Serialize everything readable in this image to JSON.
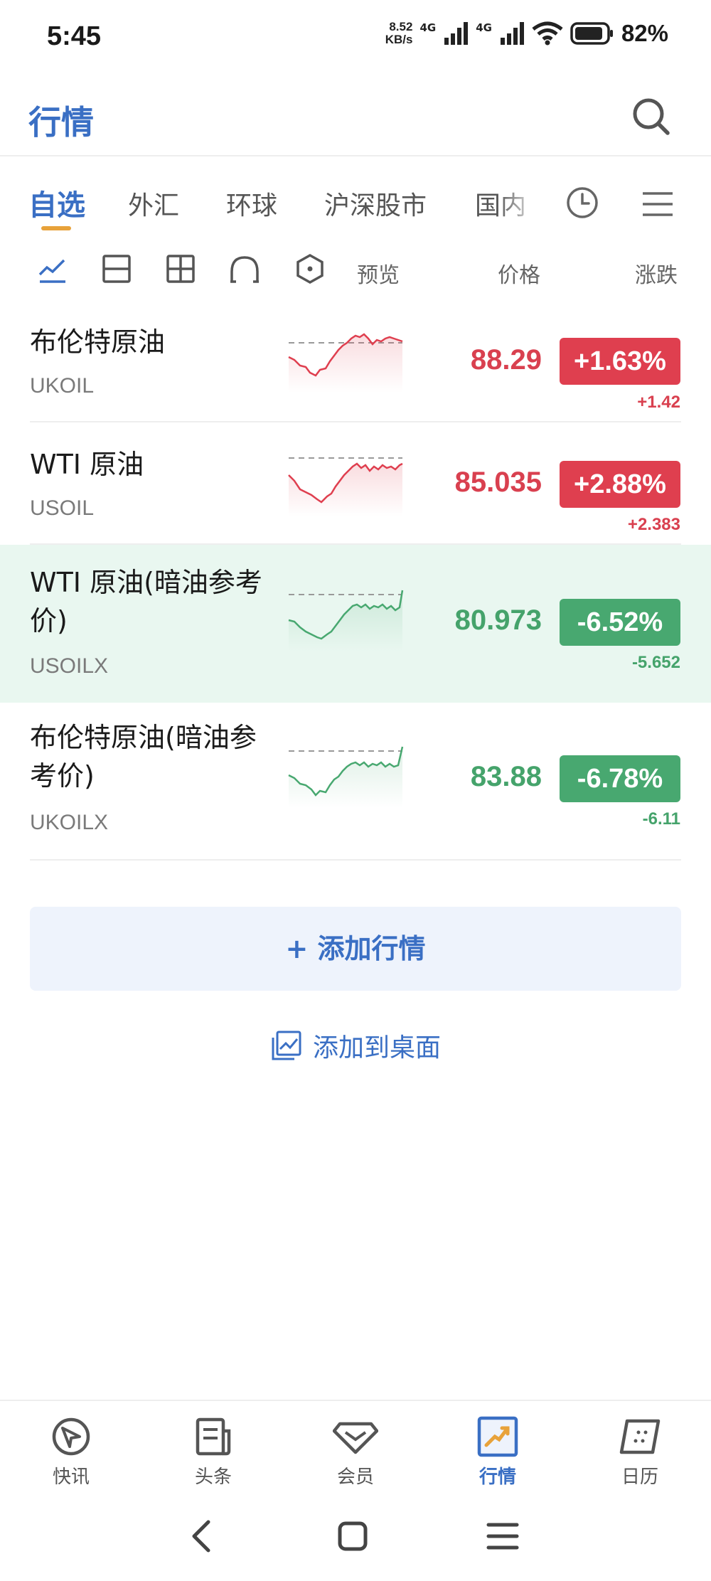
{
  "status_bar": {
    "time": "5:45",
    "speed_value": "8.52",
    "speed_unit": "KB/s",
    "network_1": "4G",
    "network_2": "4G",
    "battery": "82%"
  },
  "header": {
    "title": "行情",
    "search_icon": "search-icon"
  },
  "tabs": {
    "items": [
      "自选",
      "外汇",
      "环球",
      "沪深股市",
      "国内"
    ],
    "active": "自选",
    "clock_icon": "clock-icon",
    "menu_icon": "menu-icon"
  },
  "view_modes": {
    "icons": [
      "line-chart-icon",
      "split-view-icon",
      "grid-view-icon",
      "curve-icon",
      "hexagon-icon"
    ],
    "col_preview": "预览",
    "col_price": "价格",
    "col_change": "涨跌"
  },
  "quotes": [
    {
      "name": "布伦特原油",
      "code": "UKOIL",
      "price": "88.29",
      "pct": "+1.63%",
      "change": "+1.42",
      "direction": "up"
    },
    {
      "name": "WTI 原油",
      "code": "USOIL",
      "price": "85.035",
      "pct": "+2.88%",
      "change": "+2.383",
      "direction": "up"
    },
    {
      "name": "WTI 原油(暗油参考价)",
      "code": "USOILX",
      "price": "80.973",
      "pct": "-6.52%",
      "change": "-5.652",
      "direction": "down"
    },
    {
      "name": "布伦特原油(暗油参考价)",
      "code": "UKOILX",
      "price": "83.88",
      "pct": "-6.78%",
      "change": "-6.11",
      "direction": "down"
    }
  ],
  "actions": {
    "add_quote": "+ 添加行情",
    "add_desktop": "添加到桌面"
  },
  "bottom_nav": {
    "items": [
      {
        "label": "快讯",
        "icon": "flash-news-icon"
      },
      {
        "label": "头条",
        "icon": "newspaper-icon"
      },
      {
        "label": "会员",
        "icon": "diamond-icon"
      },
      {
        "label": "行情",
        "icon": "market-trend-icon"
      },
      {
        "label": "日历",
        "icon": "calendar-icon"
      }
    ],
    "active": "行情"
  },
  "colors": {
    "accent": "#3a6fc4",
    "up": "#df3f4f",
    "down": "#48a870",
    "highlight_row": "#e9f7f0",
    "tab_indicator": "#e8a23a"
  }
}
